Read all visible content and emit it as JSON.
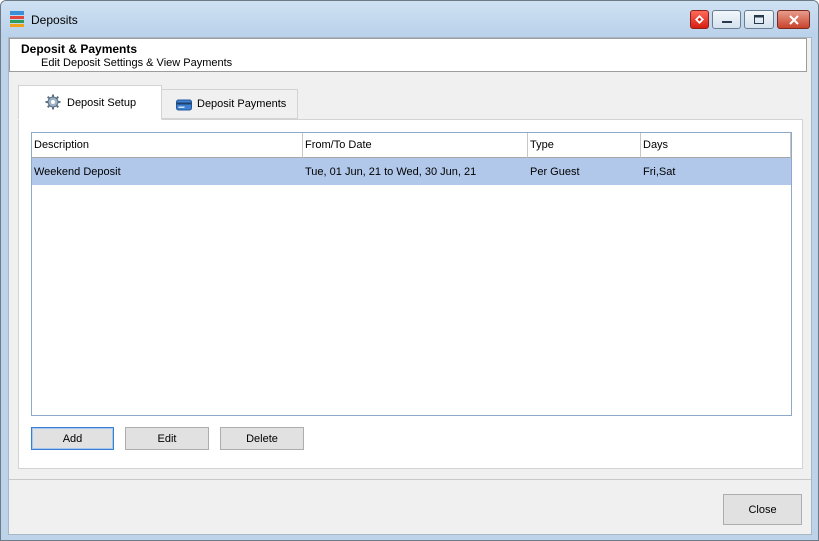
{
  "window": {
    "title": "Deposits"
  },
  "header": {
    "title": "Deposit & Payments",
    "subtitle": "Edit Deposit Settings & View Payments"
  },
  "tabs": [
    {
      "label": "Deposit Setup",
      "icon": "gear-icon",
      "active": true
    },
    {
      "label": "Deposit Payments",
      "icon": "card-icon",
      "active": false
    }
  ],
  "table": {
    "columns": [
      "Description",
      "From/To Date",
      "Type",
      "Days"
    ],
    "rows": [
      {
        "description": "Weekend Deposit",
        "date_range": "Tue, 01 Jun, 21 to Wed, 30 Jun, 21",
        "type": "Per Guest",
        "days": "Fri,Sat"
      }
    ],
    "selected_row_color": "#b2c8ea"
  },
  "buttons": {
    "add": "Add",
    "edit": "Edit",
    "delete": "Delete",
    "close": "Close"
  }
}
